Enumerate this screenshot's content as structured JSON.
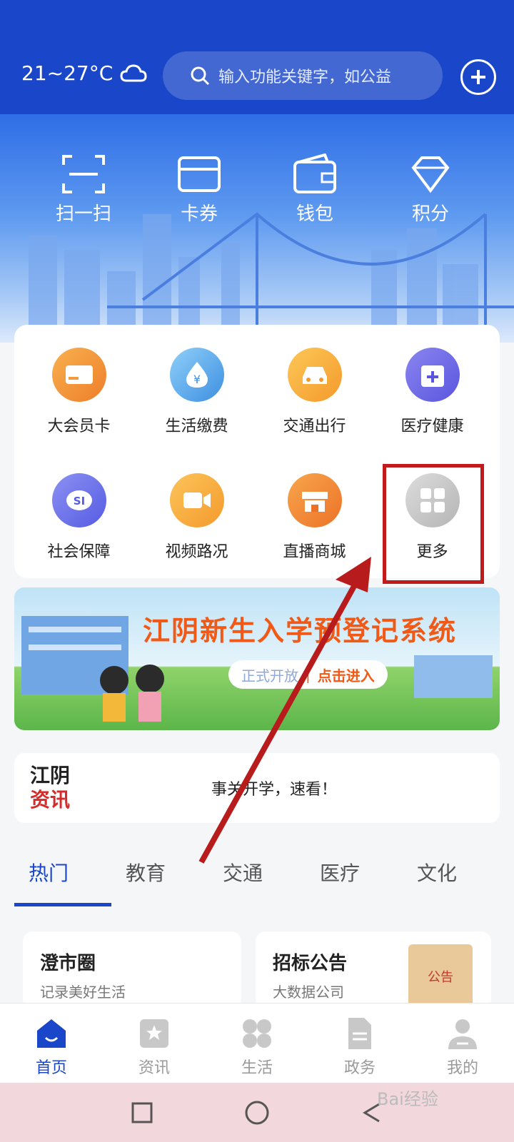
{
  "header": {
    "weather": "21~27°C",
    "search_placeholder": "输入功能关键字，如公益"
  },
  "quick_actions": [
    {
      "label": "扫一扫",
      "icon": "scan-icon"
    },
    {
      "label": "卡券",
      "icon": "card-icon"
    },
    {
      "label": "钱包",
      "icon": "wallet-icon"
    },
    {
      "label": "积分",
      "icon": "diamond-icon"
    }
  ],
  "services": [
    {
      "label": "大会员卡",
      "icon": "member-card-icon",
      "color": "#f39a3c"
    },
    {
      "label": "生活缴费",
      "icon": "payment-icon",
      "color": "#5aa6e6"
    },
    {
      "label": "交通出行",
      "icon": "car-icon",
      "color": "#f7a93a"
    },
    {
      "label": "医疗健康",
      "icon": "calendar-plus-icon",
      "color": "#6f6ae8"
    },
    {
      "label": "社会保障",
      "icon": "social-security-icon",
      "color": "#6b72ea"
    },
    {
      "label": "视频路况",
      "icon": "video-icon",
      "color": "#f7a53a"
    },
    {
      "label": "直播商城",
      "icon": "shop-icon",
      "color": "#f28a3a"
    },
    {
      "label": "更多",
      "icon": "more-grid-icon",
      "color": "#cfcfcf"
    }
  ],
  "banner": {
    "title": "江阴新生入学预登记系统",
    "cta_left": "正式开放",
    "cta_right": "点击进入"
  },
  "ticker": {
    "logo_line1": "江阴",
    "logo_line2": "资讯",
    "text": "事关开学，速看！"
  },
  "tabs": [
    "热门",
    "教育",
    "交通",
    "医疗",
    "文化"
  ],
  "cards": [
    {
      "title": "澄市圈",
      "subtitle": "记录美好生活"
    },
    {
      "title": "招标公告",
      "subtitle": "大数据公司",
      "badge": "公告"
    }
  ],
  "bottom_nav": [
    {
      "label": "首页",
      "icon": "home-icon",
      "active": true
    },
    {
      "label": "资讯",
      "icon": "news-icon",
      "active": false
    },
    {
      "label": "生活",
      "icon": "life-icon",
      "active": false
    },
    {
      "label": "政务",
      "icon": "document-icon",
      "active": false
    },
    {
      "label": "我的",
      "icon": "profile-icon",
      "active": false
    }
  ],
  "watermark": "Bai经验"
}
